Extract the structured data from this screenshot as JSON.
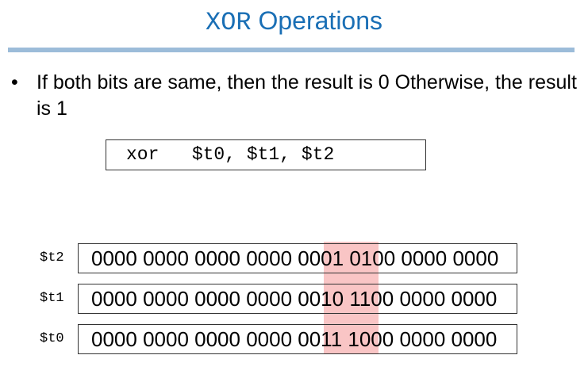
{
  "title": {
    "mono": "XOR",
    "rest": " Operations"
  },
  "bullet": {
    "marker": "•",
    "text": "If both bits are same, then the result is 0 Otherwise, the result is 1"
  },
  "code": "xor   $t0, $t1, $t2",
  "registers": [
    {
      "label": "$t2",
      "bits": "0000 0000 0000 0000 0001 0100 0000 0000"
    },
    {
      "label": "$t1",
      "bits": "0000 0000 0000 0000 0010 1100 0000 0000"
    },
    {
      "label": "$t0",
      "bits": "0000 0000 0000 0000 0011 1000 0000 0000"
    }
  ],
  "colors": {
    "title": "#1a6fb5",
    "rule": "#9cbcd9",
    "highlight": "#f48c8c"
  }
}
